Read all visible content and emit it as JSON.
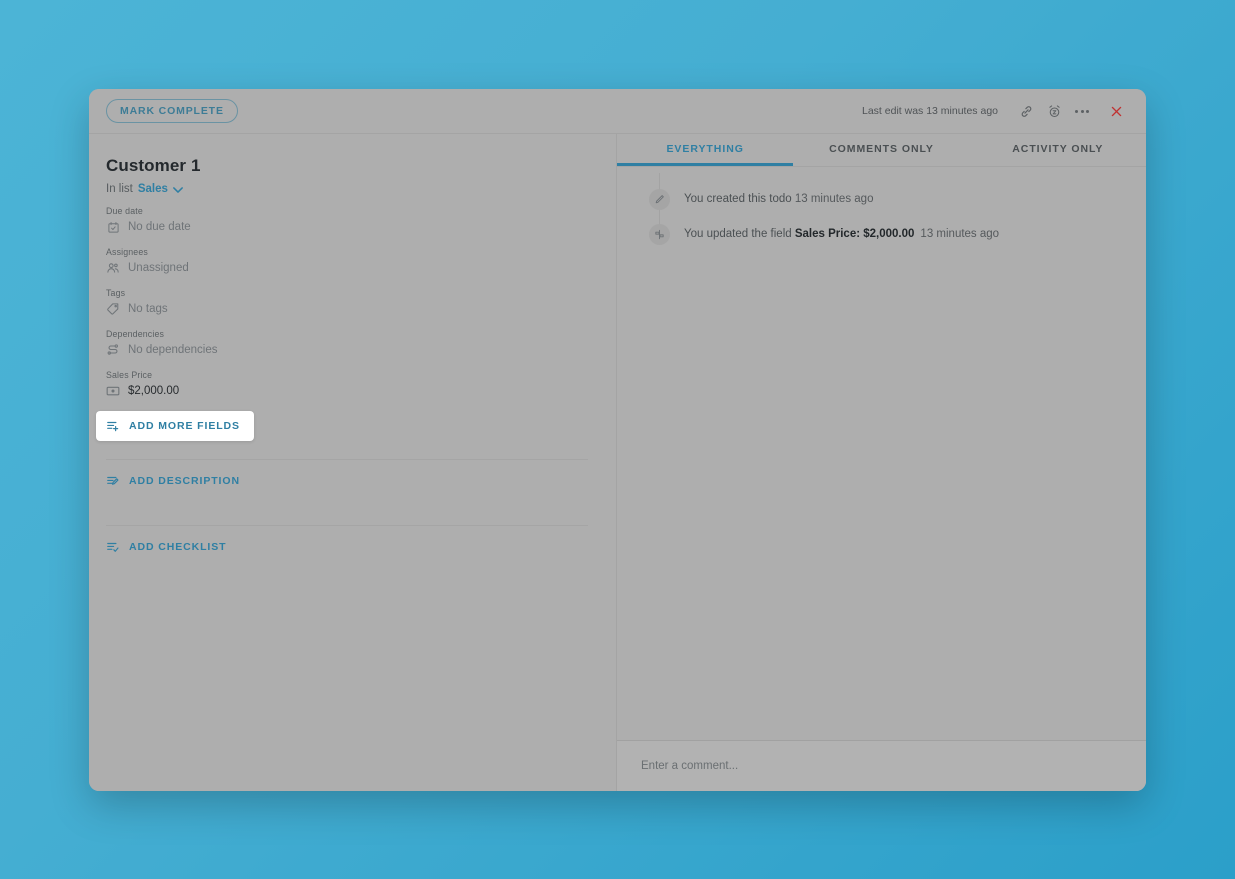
{
  "topbar": {
    "mark_complete_label": "MARK COMPLETE",
    "last_edit": "Last edit was 13 minutes ago",
    "link_icon": "link-icon",
    "snooze_icon": "alarm-snooze-icon",
    "more_icon": "ellipsis-icon",
    "close_icon": "close-icon"
  },
  "card": {
    "title": "Customer 1",
    "in_list_prefix": "In list",
    "list_name": "Sales",
    "fields": [
      {
        "label": "Due date",
        "value": "No due date",
        "icon": "calendar-icon",
        "filled": false
      },
      {
        "label": "Assignees",
        "value": "Unassigned",
        "icon": "people-icon",
        "filled": false
      },
      {
        "label": "Tags",
        "value": "No tags",
        "icon": "tag-icon",
        "filled": false
      },
      {
        "label": "Dependencies",
        "value": "No dependencies",
        "icon": "dependencies-icon",
        "filled": false
      },
      {
        "label": "Sales Price",
        "value": "$2,000.00",
        "icon": "money-icon",
        "filled": true
      }
    ],
    "add_more_fields_label": "ADD MORE FIELDS",
    "add_description_label": "ADD DESCRIPTION",
    "add_checklist_label": "ADD CHECKLIST"
  },
  "activity": {
    "tabs": [
      {
        "label": "EVERYTHING",
        "active": true
      },
      {
        "label": "COMMENTS ONLY",
        "active": false
      },
      {
        "label": "ACTIVITY ONLY",
        "active": false
      }
    ],
    "items": [
      {
        "icon": "pencil-icon",
        "text_before": "You created this todo ",
        "bold": "",
        "text_after": "",
        "timestamp": "13 minutes ago"
      },
      {
        "icon": "field-edit-icon",
        "text_before": "You updated the field ",
        "bold": "Sales Price: $2,000.00",
        "text_after": "",
        "timestamp": "13 minutes ago"
      }
    ],
    "comment_placeholder": "Enter a comment..."
  },
  "colors": {
    "accent": "#2f7fa3",
    "close_red": "#c03232",
    "background_teal": "#45aed2",
    "modal_gray": "#aeaeae"
  }
}
